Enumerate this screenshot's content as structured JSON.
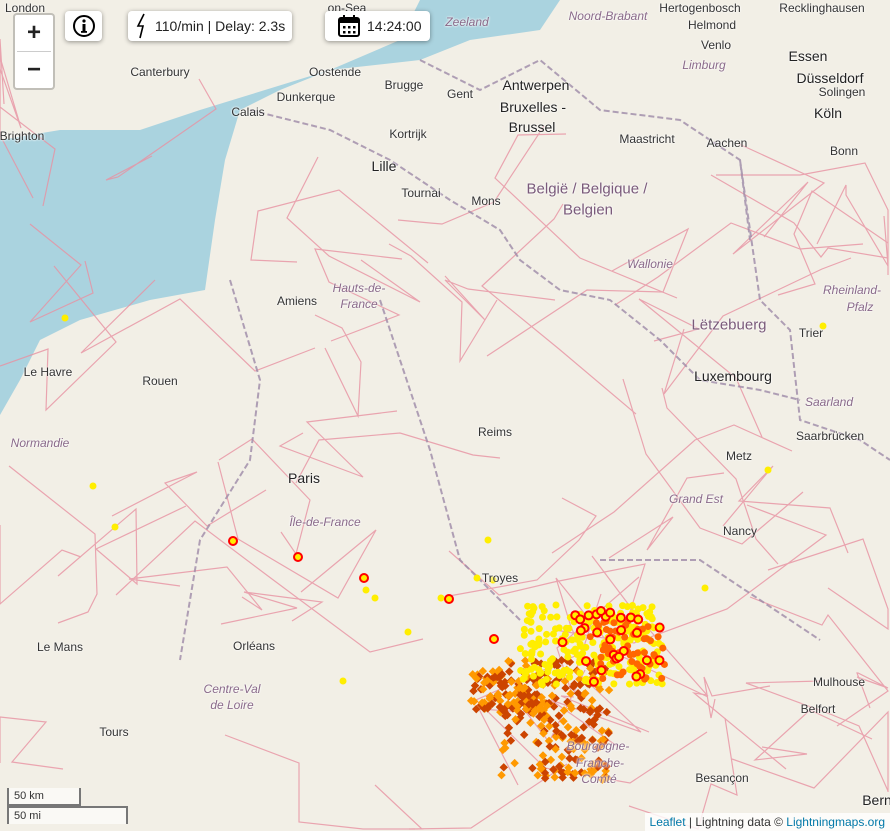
{
  "controls": {
    "zoom_in": "+",
    "zoom_out": "−",
    "info_icon": "info-icon",
    "rate_text": "110/min | Delay: 2.3s",
    "time_text": "14:24:00"
  },
  "scale": {
    "km": "50 km",
    "mi": "50 mi"
  },
  "attribution": {
    "leaflet": "Leaflet",
    "sep": " | Lightning data © ",
    "source": "Lightningmaps.org"
  },
  "colors": {
    "sea": "#aad3df",
    "land": "#f2efe6",
    "road": "#e892a2",
    "border": "#9e8aa8",
    "strike_new": "#ffee00",
    "strike_mid": "#ff9900",
    "strike_old": "#cc4400",
    "strike_ring": "#ff0000"
  },
  "labels": [
    "London",
    "on-Sea",
    "Canterbury",
    "Brighton",
    "Calais",
    "Dunkerque",
    "Oostende",
    "Brugge",
    "Gent",
    "Antwerpen",
    "Bruxelles -",
    "Brussel",
    "Kortrijk",
    "Lille",
    "Tournai",
    "Mons",
    "Maastricht",
    "Aachen",
    "Köln",
    "Bonn",
    "Düsseldorf",
    "Essen",
    "Solingen",
    "Venlo",
    "Helmond",
    "Noord-Brabant",
    "Zeeland",
    "Limburg",
    "België / Belgique /",
    "Belgien",
    "Wallonie",
    "Hauts-de-",
    "France",
    "Amiens",
    "Rouen",
    "Le Havre",
    "Normandie",
    "Lëtzebuerg",
    "Luxembourg",
    "Trier",
    "Rheinland-",
    "Pfalz",
    "Saarland",
    "Saarbrücken",
    "Metz",
    "Reims",
    "Paris",
    "Île-de-France",
    "Grand Est",
    "Nancy",
    "Troyes",
    "Orléans",
    "Le Mans",
    "Centre-Val",
    "de Loire",
    "Tours",
    "Mulhouse",
    "Belfort",
    "Besançon",
    "Bourgogne-",
    "Franche-",
    "Comté",
    "Recklinghausen",
    "Hertogenbosch",
    "Bern"
  ]
}
